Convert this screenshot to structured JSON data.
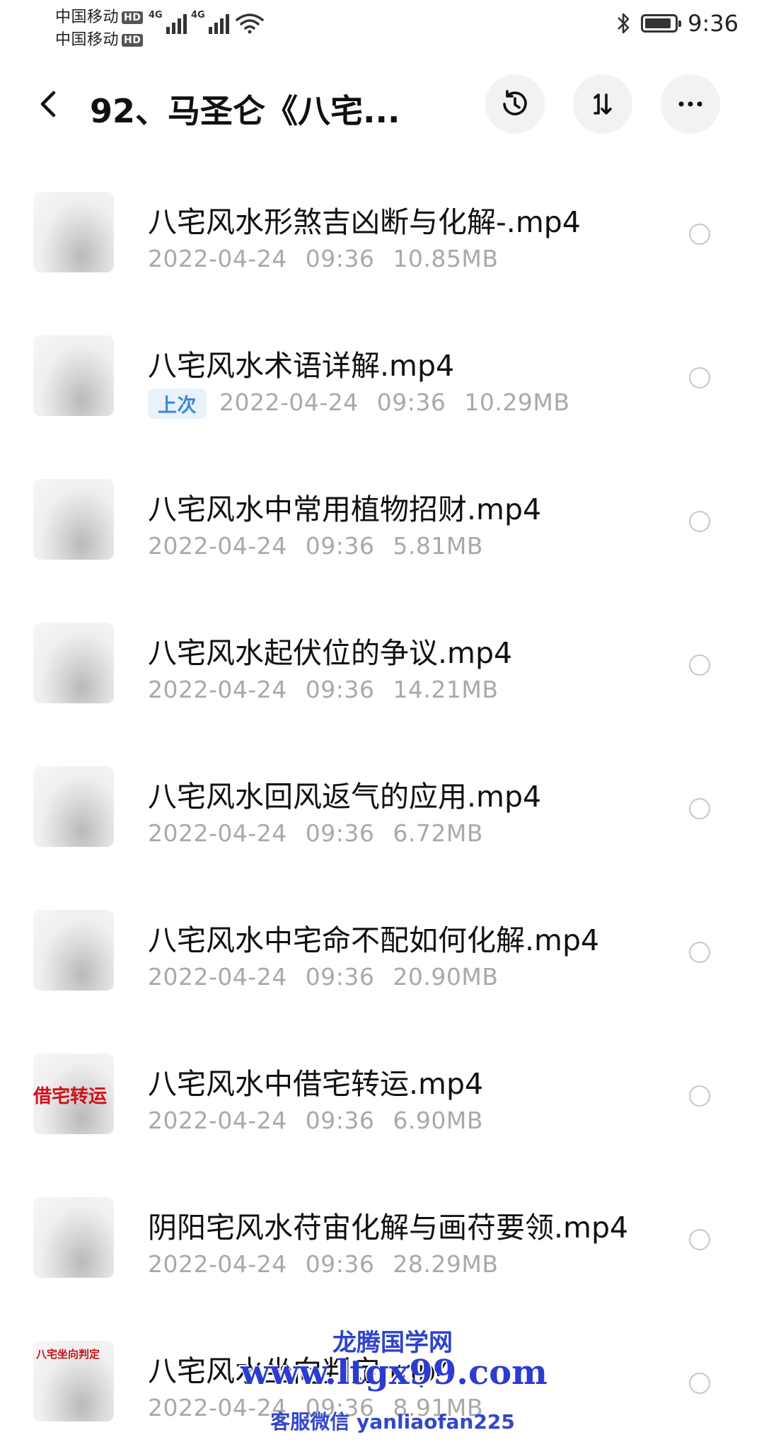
{
  "status_bar": {
    "carrier1": "中国移动",
    "carrier2": "中国移动",
    "hd_badge": "HD",
    "net_type": "4G",
    "time": "9:36",
    "battery_level": 0.9,
    "icons": [
      "signal-icon",
      "wifi-icon",
      "bluetooth-icon",
      "battery-icon"
    ]
  },
  "header": {
    "title": "92、马圣仑《八宅...",
    "back_icon": "back-arrow-icon",
    "history_icon": "history-icon",
    "sort_icon": "sort-icon",
    "more_icon": "more-icon"
  },
  "files": [
    {
      "name": "八宅风水形煞吉凶断与化解-.mp4",
      "date": "2022-04-24",
      "time": "09:36",
      "size": "10.85MB",
      "tag": "",
      "thumb_title": "",
      "thumb_big": ""
    },
    {
      "name": "八宅风水术语详解.mp4",
      "date": "2022-04-24",
      "time": "09:36",
      "size": "10.29MB",
      "tag": "上次",
      "thumb_title": "",
      "thumb_big": ""
    },
    {
      "name": "八宅风水中常用植物招财.mp4",
      "date": "2022-04-24",
      "time": "09:36",
      "size": "5.81MB",
      "tag": "",
      "thumb_title": "",
      "thumb_big": ""
    },
    {
      "name": "八宅风水起伏位的争议.mp4",
      "date": "2022-04-24",
      "time": "09:36",
      "size": "14.21MB",
      "tag": "",
      "thumb_title": "",
      "thumb_big": ""
    },
    {
      "name": "八宅风水回风返气的应用.mp4",
      "date": "2022-04-24",
      "time": "09:36",
      "size": "6.72MB",
      "tag": "",
      "thumb_title": "",
      "thumb_big": ""
    },
    {
      "name": "八宅风水中宅命不配如何化解.mp4",
      "date": "2022-04-24",
      "time": "09:36",
      "size": "20.90MB",
      "tag": "",
      "thumb_title": "",
      "thumb_big": ""
    },
    {
      "name": "八宅风水中借宅转运.mp4",
      "date": "2022-04-24",
      "time": "09:36",
      "size": "6.90MB",
      "tag": "",
      "thumb_title": "",
      "thumb_big": "借宅转运"
    },
    {
      "name": "阴阳宅风水苻宙化解与画苻要领.mp4",
      "date": "2022-04-24",
      "time": "09:36",
      "size": "28.29MB",
      "tag": "",
      "thumb_title": "",
      "thumb_big": ""
    },
    {
      "name": "八宅风水坐向判定.mp4",
      "date": "2022-04-24",
      "time": "09:36",
      "size": "8.91MB",
      "tag": "",
      "thumb_title": "八宅坐向判定",
      "thumb_big": ""
    }
  ],
  "watermark": {
    "line1": "龙腾国学网",
    "line2": "www.ltgx99.com",
    "line3": "客服微信 yanliaofan225"
  }
}
